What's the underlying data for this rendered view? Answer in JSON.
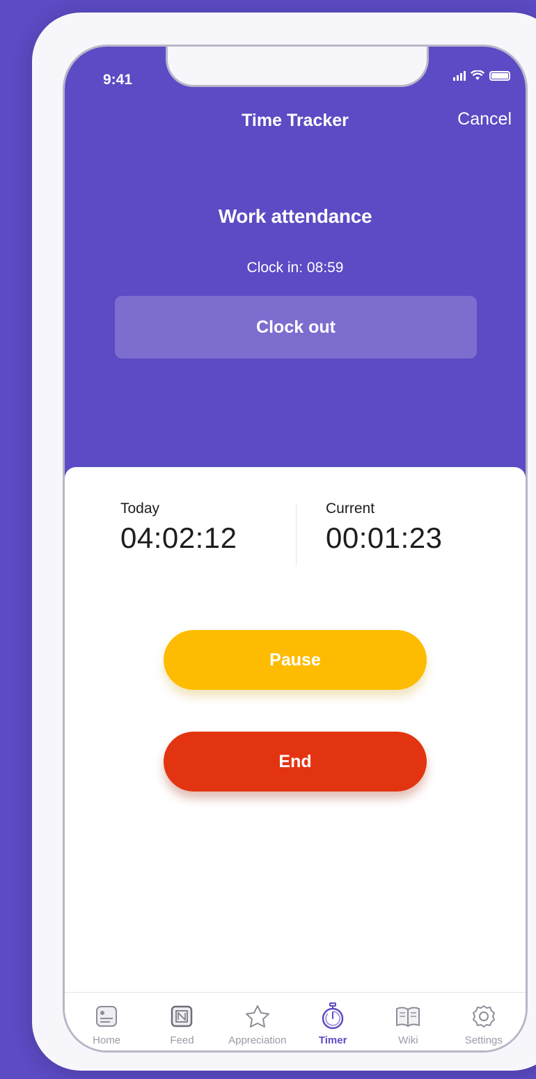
{
  "status_bar": {
    "time": "9:41"
  },
  "nav": {
    "title": "Time Tracker",
    "cancel_label": "Cancel"
  },
  "attendance": {
    "title": "Work attendance",
    "clock_in": "Clock in: 08:59",
    "clock_out_label": "Clock out"
  },
  "stats": {
    "today": {
      "label": "Today",
      "value": "04:02:12"
    },
    "current": {
      "label": "Current",
      "value": "00:01:23"
    }
  },
  "actions": {
    "pause_label": "Pause",
    "end_label": "End"
  },
  "tabs": [
    {
      "label": "Home",
      "icon": "home-card-icon"
    },
    {
      "label": "Feed",
      "icon": "feed-icon"
    },
    {
      "label": "Appreciation",
      "icon": "star-icon"
    },
    {
      "label": "Timer",
      "icon": "stopwatch-icon",
      "active": true
    },
    {
      "label": "Wiki",
      "icon": "book-icon"
    },
    {
      "label": "Settings",
      "icon": "gear-icon"
    }
  ],
  "colors": {
    "brand": "#5b4bc4",
    "pause": "#fdbc02",
    "end": "#e33412",
    "tab_inactive": "#9a9aa6"
  }
}
